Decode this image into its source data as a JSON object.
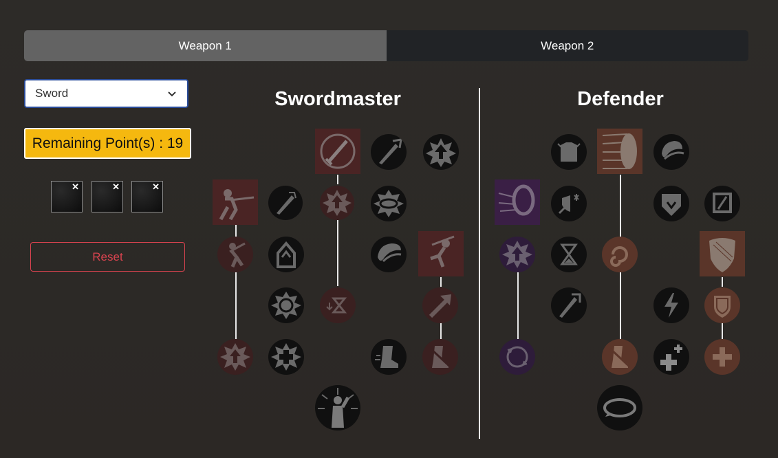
{
  "tabs": [
    {
      "label": "Weapon 1"
    },
    {
      "label": "Weapon 2"
    }
  ],
  "weapon_select": {
    "value": "Sword"
  },
  "points": {
    "label": "Remaining Point(s) : 19"
  },
  "slots": [
    {
      "close": "✕"
    },
    {
      "close": "✕"
    },
    {
      "close": "✕"
    }
  ],
  "reset_label": "Reset",
  "trees": [
    {
      "title": "Swordmaster"
    },
    {
      "title": "Defender"
    }
  ],
  "colors": {
    "accent_gold": "#f5b80f",
    "reset_red": "#d9434f",
    "tab_active": "#636363",
    "tab_inactive": "#212326",
    "node_red": "#4a2424",
    "node_purple": "#3a1f45",
    "node_brown": "#5a3529",
    "node_dark": "#101010"
  }
}
